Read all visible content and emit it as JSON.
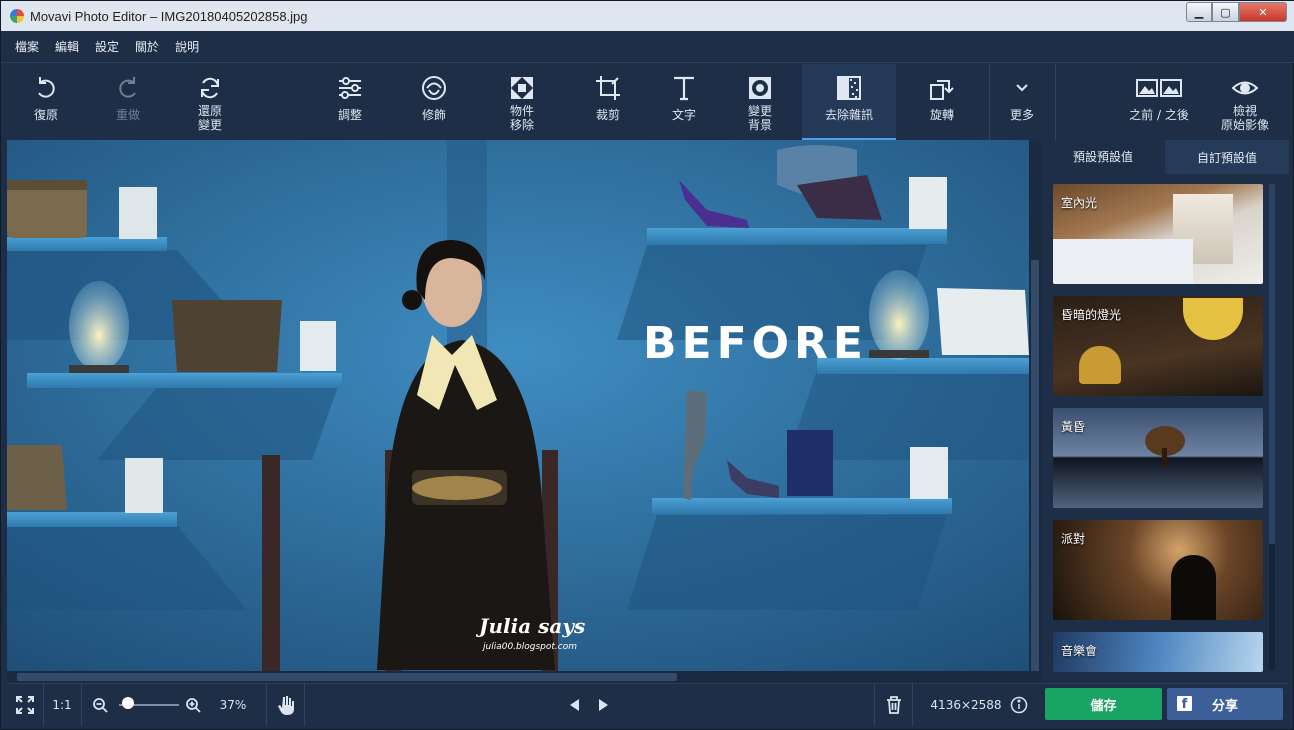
{
  "window": {
    "title": "Movavi Photo Editor – IMG20180405202858.jpg"
  },
  "menu": [
    "檔案",
    "編輯",
    "設定",
    "關於",
    "說明"
  ],
  "toolbar": {
    "undo": "復原",
    "redo": "重做",
    "revert": [
      "還原",
      "變更"
    ],
    "adjust": "調整",
    "retouch": "修飾",
    "object_removal": [
      "物件",
      "移除"
    ],
    "crop": "裁剪",
    "text": "文字",
    "change_bg": [
      "變更",
      "背景"
    ],
    "denoise": "去除雜訊",
    "rotate": "旋轉",
    "more": "更多",
    "before_after": "之前 / 之後",
    "view_original": [
      "檢視",
      "原始影像"
    ]
  },
  "canvas": {
    "overlay_text": "BEFORE",
    "watermark_title": "Julia says",
    "watermark_url": "julia00.blogspot.com"
  },
  "panel": {
    "tabs": [
      "預設預設值",
      "自訂預設值"
    ],
    "active_tab": 0,
    "presets": [
      "室內光",
      "昏暗的燈光",
      "黃昏",
      "派對",
      "音樂會"
    ]
  },
  "bottom": {
    "one_to_one": "1:1",
    "zoom": "37%",
    "zoom_level": 0.08,
    "dimensions": "4136×2588",
    "save": "儲存",
    "share": "分享"
  },
  "colors": {
    "accent": "#4a9ff0",
    "save": "#19a463",
    "share": "#3d5f97"
  }
}
